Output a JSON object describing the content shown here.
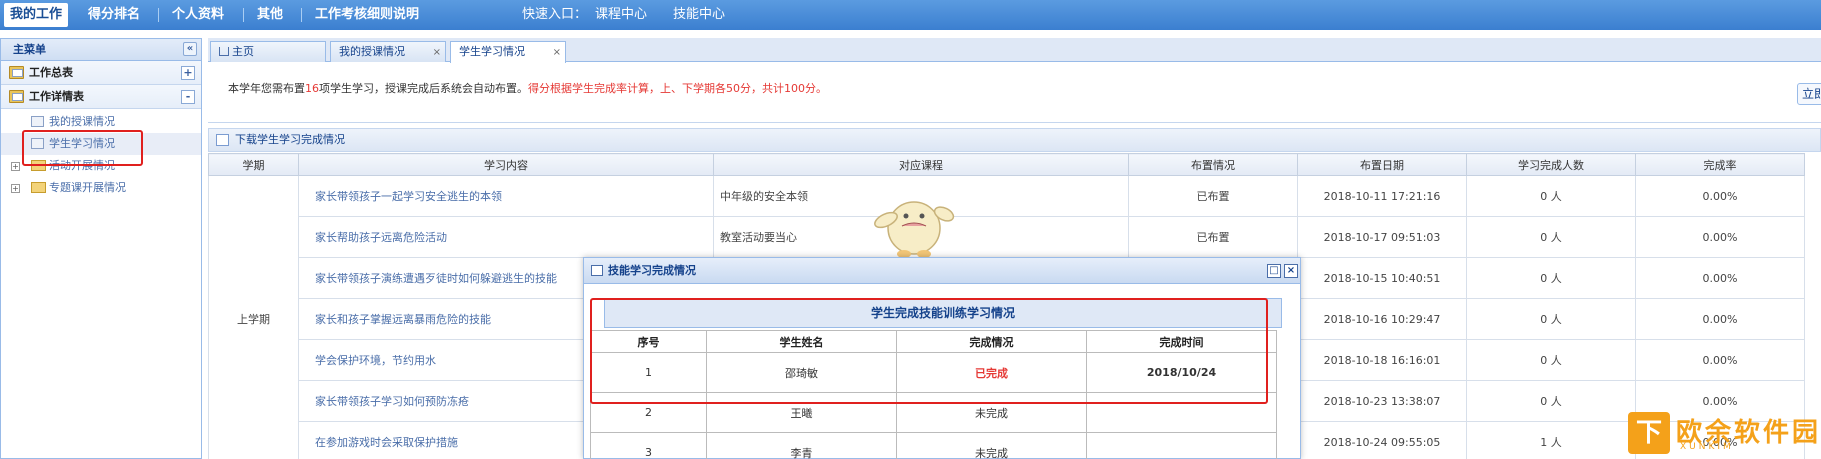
{
  "topnav": {
    "items": [
      "我的工作",
      "得分排名",
      "个人资料",
      "其他",
      "工作考核细则说明"
    ],
    "quick_entry_label": "快速入口：",
    "quick_links": [
      "课程中心",
      "技能中心"
    ]
  },
  "sidebar": {
    "title": "主菜单",
    "collapse_glyph": "«",
    "groups": [
      {
        "label": "工作总表",
        "toggle": "+"
      },
      {
        "label": "工作详情表",
        "toggle": "-"
      }
    ],
    "items": [
      {
        "label": "我的授课情况"
      },
      {
        "label": "学生学习情况"
      },
      {
        "label": "活动开展情况",
        "expander": "+"
      },
      {
        "label": "专题课开展情况",
        "expander": "+"
      }
    ]
  },
  "tabs": [
    {
      "label": "主页"
    },
    {
      "label": "我的授课情况",
      "close": "×"
    },
    {
      "label": "学生学习情况",
      "close": "×"
    }
  ],
  "notice": {
    "text_before": "本学年您需布置",
    "count": "16",
    "text_middle": "项学生学习，授课完成后系统会自动布置。",
    "red_text": "得分根据学生完成率计算，上、下学期各50分，共计100分。",
    "button_label": "立即"
  },
  "download_label": "下载学生学习完成情况",
  "table": {
    "headers": [
      "学期",
      "学习内容",
      "对应课程",
      "布置情况",
      "布置日期",
      "学习完成人数",
      "完成率"
    ],
    "term": "上学期",
    "rows": [
      {
        "content": "家长带领孩子一起学习安全逃生的本领",
        "course": "中年级的安全本领",
        "status": "已布置",
        "date": "2018-10-11 17:21:16",
        "count": "0 人",
        "rate": "0.00%"
      },
      {
        "content": "家长帮助孩子远离危险活动",
        "course": "教室活动要当心",
        "status": "已布置",
        "date": "2018-10-17 09:51:03",
        "count": "0 人",
        "rate": "0.00%"
      },
      {
        "content": "家长带领孩子演练遭遇歹徒时如何躲避逃生的技能",
        "course": "",
        "status": "",
        "date": "2018-10-15 10:40:51",
        "count": "0 人",
        "rate": "0.00%"
      },
      {
        "content": "家长和孩子掌握远离暴雨危险的技能",
        "course": "",
        "status": "",
        "date": "2018-10-16 10:29:47",
        "count": "0 人",
        "rate": "0.00%"
      },
      {
        "content": "学会保护环境，节约用水",
        "course": "",
        "status": "",
        "date": "2018-10-18 16:16:01",
        "count": "0 人",
        "rate": "0.00%"
      },
      {
        "content": "家长带领孩子学习如何预防冻疮",
        "course": "",
        "status": "",
        "date": "2018-10-23 13:38:07",
        "count": "0 人",
        "rate": "0.00%"
      },
      {
        "content": "在参加游戏时会采取保护措施",
        "course": "",
        "status": "",
        "date": "2018-10-24 09:55:05",
        "count": "1 人",
        "rate": "0.00%"
      }
    ]
  },
  "popup": {
    "title": "技能学习完成情况",
    "max_glyph": "□",
    "close_glyph": "×",
    "inner_title": "学生完成技能训练学习情况",
    "headers": [
      "序号",
      "学生姓名",
      "完成情况",
      "完成时间"
    ],
    "rows": [
      {
        "no": "1",
        "name": "邵琦敏",
        "status": "已完成",
        "time": "2018/10/24"
      },
      {
        "no": "2",
        "name": "王曦",
        "status": "未完成",
        "time": ""
      },
      {
        "no": "3",
        "name": "李青",
        "status": "未完成",
        "time": ""
      }
    ]
  },
  "watermark": {
    "badge": "下",
    "text": "欧余软件园",
    "sub": "XUNKIM"
  },
  "colors": {
    "nav_blue": "#3b7fd0",
    "highlight_red": "#e0201e",
    "link_blue": "#4a6ea9",
    "watermark_orange": "#f4a11a"
  }
}
